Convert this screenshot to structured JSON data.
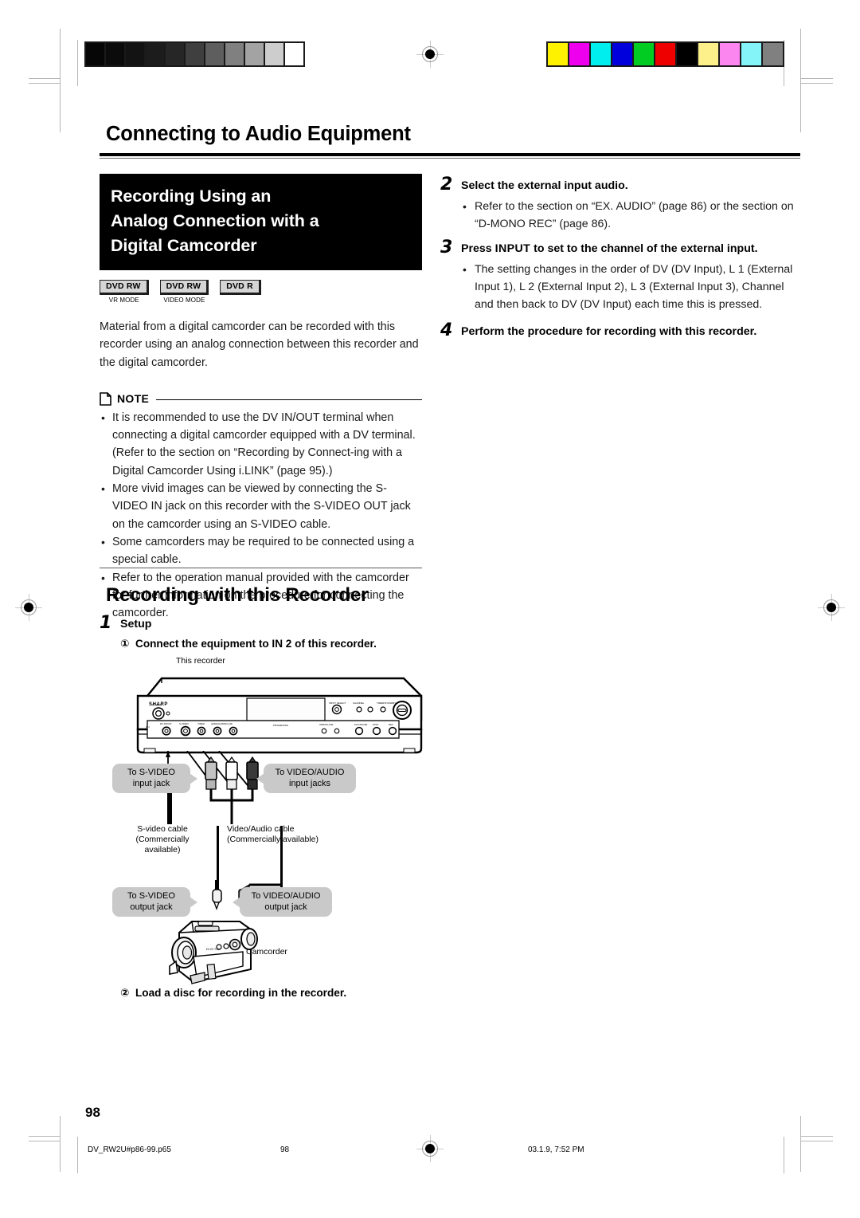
{
  "page": {
    "title": "Connecting to Audio Equipment",
    "number": "98"
  },
  "section_banner": {
    "line1": "Recording Using an",
    "line2": "Analog Connection with a",
    "line3": "Digital Camcorder"
  },
  "badges": [
    {
      "label": "DVD RW",
      "sub": "VR MODE"
    },
    {
      "label": "DVD RW",
      "sub": "VIDEO MODE"
    },
    {
      "label": "DVD R",
      "sub": ""
    }
  ],
  "intro": "Material from a digital camcorder can be recorded with this recorder using an analog connection between this recorder and the digital camcorder.",
  "note": {
    "label": "NOTE",
    "items": [
      "It is recommended to use the DV IN/OUT terminal when connecting a digital camcorder equipped with a DV terminal. (Refer to the section on “Recording by Connect-ing with a Digital Camcorder Using i.LINK” (page 95).)",
      "More vivid images can be viewed by connecting the S-VIDEO IN jack on this recorder with the S-VIDEO OUT jack on the camcorder using an S-VIDEO cable.",
      "Some camcorders may be required to be connected using a special cable.",
      "Refer to the operation manual provided with the camcorder for further information on the procedure for connecting the camcorder."
    ]
  },
  "section2": {
    "title": "Recording with this Recorder",
    "step1": {
      "num": "1",
      "head": "Setup",
      "sub1_marker": "①",
      "sub1": "Connect the equipment to IN 2 of this recorder.",
      "sub2_marker": "②",
      "sub2": "Load a disc for recording in the recorder."
    }
  },
  "figure": {
    "recorder_label": "This recorder",
    "brand": "SHARP",
    "callout_svideo_in": "To S-VIDEO\ninput jack",
    "callout_svideo_in_l1": "To S-VIDEO",
    "callout_svideo_in_l2": "input jack",
    "callout_av_in_l1": "To VIDEO/AUDIO",
    "callout_av_in_l2": "input jacks",
    "cable_svideo_l1": "S-video cable",
    "cable_svideo_l2": "(Commercially",
    "cable_svideo_l3": "available)",
    "cable_av_l1": "Video/Audio cable",
    "cable_av_l2": "(Commercially available)",
    "callout_svideo_out_l1": "To S-VIDEO",
    "callout_svideo_out_l2": "output jack",
    "callout_av_out_l1": "To VIDEO/AUDIO",
    "callout_av_out_l2": "output jack",
    "camcorder_label": "Camcorder"
  },
  "steps": [
    {
      "num": "2",
      "head": "Select the external input audio.",
      "bullets": [
        "Refer to the section on “EX. AUDIO” (page 86) or the section on “D-MONO REC” (page 86)."
      ]
    },
    {
      "num": "3",
      "head_pre": "Press ",
      "head_kbd": "INPUT",
      "head_post": " to set to the channel of the external input.",
      "bullets": [
        "The setting changes in the order of DV (DV Input), L 1 (External Input 1), L 2 (External Input 2), L 3 (External Input 3), Channel and then back to DV (DV Input) each time this is pressed."
      ]
    },
    {
      "num": "4",
      "head": "Perform the procedure for recording with this recorder.",
      "bullets": []
    }
  ],
  "footer": {
    "file": "DV_RW2U#p86-99.p65",
    "page": "98",
    "date": "03.1.9, 7:52 PM"
  },
  "print_marks": {
    "gray_bar": [
      "#060606",
      "#0b0b0b",
      "#131313",
      "#1c1c1c",
      "#262626",
      "#3f3f3f",
      "#5e5e5e",
      "#808080",
      "#a3a3a3",
      "#cdcdcd",
      "#ffffff"
    ],
    "color_bar": [
      "#fff200",
      "#ee00ee",
      "#00eeee",
      "#0000dd",
      "#00cc22",
      "#ee0000",
      "#000000",
      "#fdf08a",
      "#fb86f0",
      "#84f4f8",
      "#808080"
    ]
  }
}
